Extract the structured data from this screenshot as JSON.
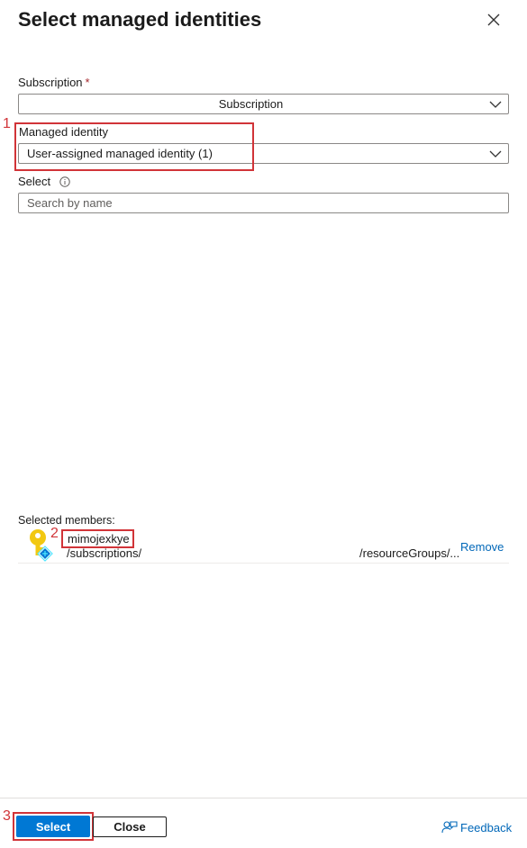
{
  "header": {
    "title": "Select managed identities",
    "close_icon": "close-icon"
  },
  "subscription": {
    "label": "Subscription",
    "required_mark": "*",
    "value": "Subscription"
  },
  "managed_identity": {
    "label": "Managed identity",
    "value": "User-assigned managed identity (1)"
  },
  "select": {
    "label": "Select",
    "placeholder": "Search by name",
    "info_icon": "info-icon"
  },
  "selected_members": {
    "label": "Selected members:",
    "items": [
      {
        "name": "mimojexkye",
        "path_start": "/subscriptions/",
        "path_end": "/resourceGroups/...",
        "remove_label": "Remove",
        "icon": "managed-identity-key-icon"
      }
    ]
  },
  "annotations": {
    "step1": "1",
    "step2": "2",
    "step3": "3",
    "color": "#d13438"
  },
  "footer": {
    "select_label": "Select",
    "close_label": "Close",
    "feedback_label": "Feedback",
    "feedback_icon": "feedback-icon"
  },
  "colors": {
    "primary": "#0078d4",
    "link": "#0067b8",
    "required": "#a4262c"
  }
}
